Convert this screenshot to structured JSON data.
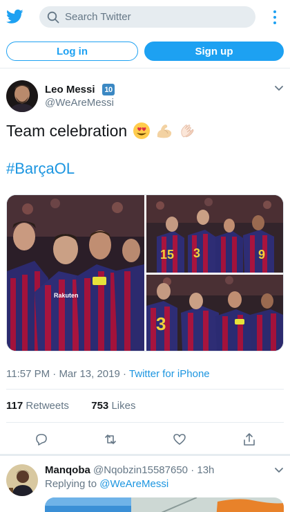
{
  "colors": {
    "brand": "#1da1f2",
    "link": "#1b95e0",
    "text": "#14171a",
    "muted": "#657786",
    "divider": "#e6ecf0"
  },
  "header": {
    "logo_icon": "twitter-bird-icon",
    "search": {
      "placeholder": "Search Twitter",
      "value": ""
    },
    "more_icon": "vertical-dots-icon"
  },
  "auth": {
    "login_label": "Log in",
    "signup_label": "Sign up"
  },
  "tweet": {
    "author": {
      "name": "Leo Messi",
      "badge": "10",
      "handle": "@WeAreMessi"
    },
    "text": "Team celebration",
    "emojis": [
      "heart-eyes-emoji",
      "flexed-biceps-emoji",
      "clapping-hands-emoji"
    ],
    "hashtag": "#BarçaOL",
    "photos": 3,
    "time": "11:57 PM",
    "date": "Mar 13, 2019",
    "source": "Twitter for iPhone",
    "retweets": {
      "count": "117",
      "label": "Retweets"
    },
    "likes": {
      "count": "753",
      "label": "Likes"
    },
    "actions": [
      "reply-icon",
      "retweet-icon",
      "like-icon",
      "share-icon"
    ]
  },
  "reply": {
    "name": "Manqoba",
    "handle": "@Nqobzin15587650",
    "time": "13h",
    "replying_label": "Replying to",
    "replying_to": "@WeAreMessi"
  }
}
